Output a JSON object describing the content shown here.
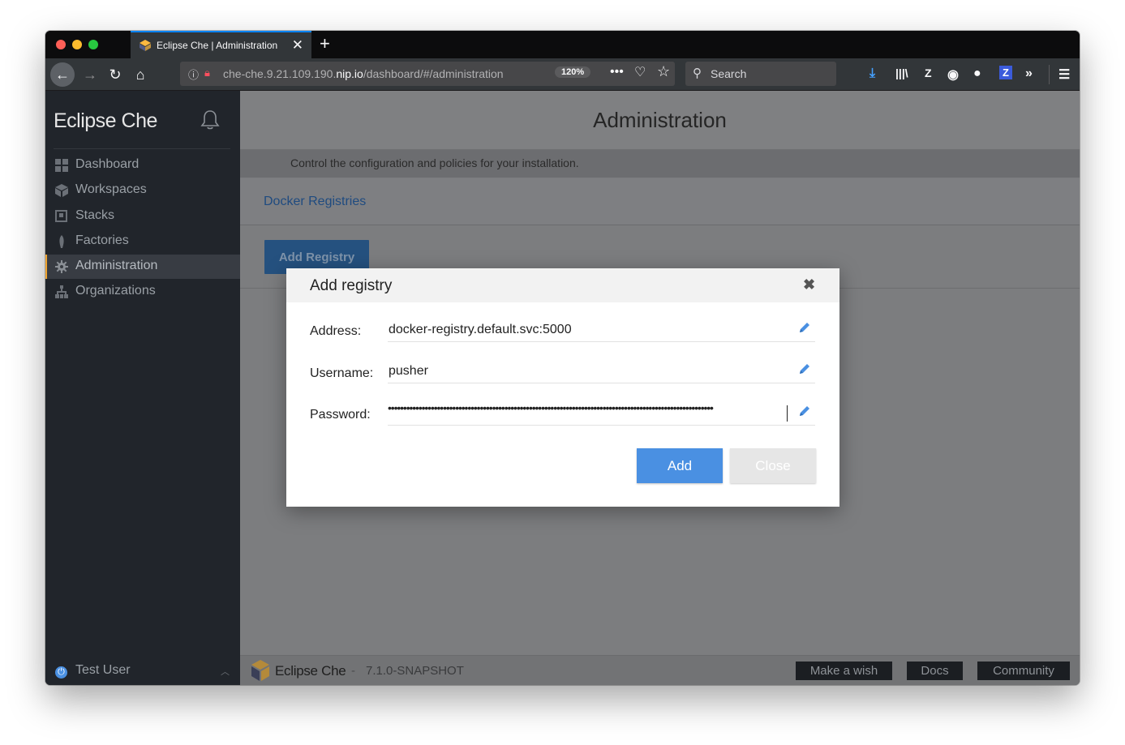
{
  "browser": {
    "tab_title": "Eclipse Che | Administration",
    "tab_close": "✕",
    "new_tab": "+",
    "url_host_prefix": "che-che.9.21.109.190.",
    "url_host_domain": "nip.io",
    "url_path": "/dashboard/#/administration",
    "zoom": "120%",
    "search_placeholder": "Search",
    "toolbar_icons": [
      "download-icon",
      "library-icon",
      "zotero-icon",
      "account-icon",
      "github-icon",
      "zotero-z-icon",
      "overflow-icon",
      "menu-icon"
    ]
  },
  "sidebar": {
    "brand": "Eclipse Che",
    "items": [
      {
        "label": "Dashboard",
        "icon": "dashboard-icon"
      },
      {
        "label": "Workspaces",
        "icon": "cube-icon"
      },
      {
        "label": "Stacks",
        "icon": "stack-icon"
      },
      {
        "label": "Factories",
        "icon": "rocket-icon"
      },
      {
        "label": "Administration",
        "icon": "gear-icon",
        "active": true
      },
      {
        "label": "Organizations",
        "icon": "org-icon"
      }
    ],
    "user": "Test User"
  },
  "main": {
    "title": "Administration",
    "subtitle": "Control the configuration and policies for your installation.",
    "tab": "Docker Registries",
    "add_registry_label": "Add Registry",
    "footer": {
      "brand": "Eclipse Che",
      "separator": "-",
      "version": "7.1.0-SNAPSHOT",
      "buttons": [
        "Make a wish",
        "Docs",
        "Community"
      ]
    }
  },
  "modal": {
    "title": "Add registry",
    "close_symbol": "✖",
    "fields": {
      "address": {
        "label": "Address:",
        "value": "docker-registry.default.svc:5000"
      },
      "username": {
        "label": "Username:",
        "value": "pusher"
      },
      "password": {
        "label": "Password:",
        "value": "••••••••••••••••••••••••••••••••••••••••••••••••••••••••••••••••••••••••••••••••••••••••••••••••••••••••••"
      }
    },
    "add_label": "Add",
    "close_label": "Close"
  },
  "colors": {
    "accent": "#4a90e2",
    "sidebar_active_marker": "#f0a531",
    "firefox_tab_highlight": "#0a84ff"
  }
}
